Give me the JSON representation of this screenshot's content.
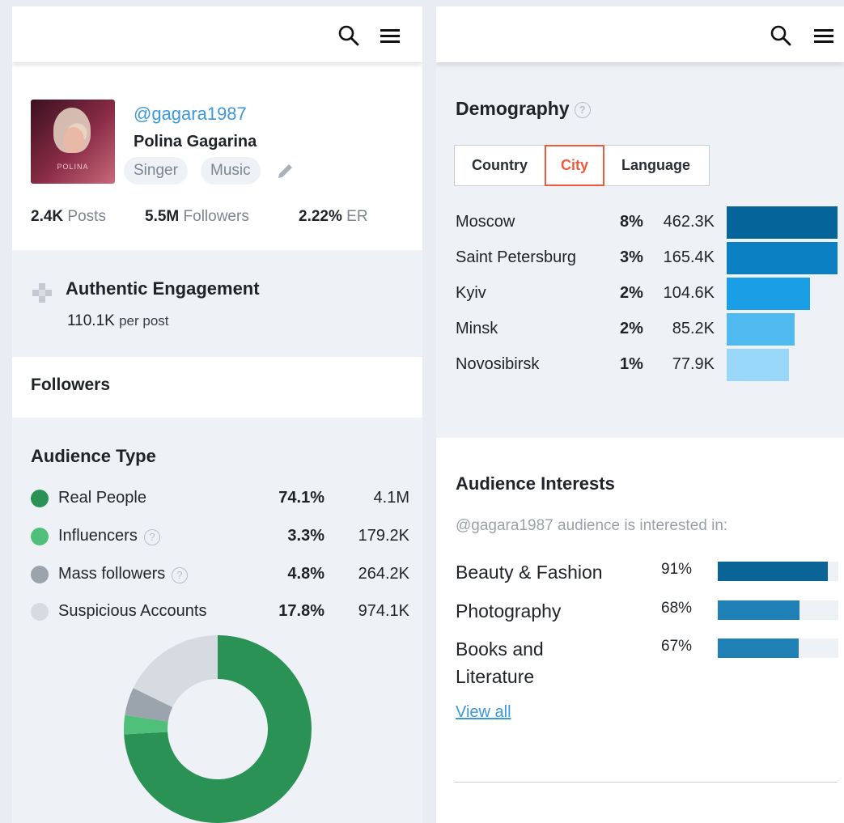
{
  "left_panel": {
    "profile": {
      "handle": "@gagara1987",
      "name": "Polina Gagarina",
      "avatar_text": "POLINA",
      "tags": [
        "Singer",
        "Music"
      ]
    },
    "stats": {
      "posts_value": "2.4K",
      "posts_label": "Posts",
      "followers_value": "5.5M",
      "followers_label": "Followers",
      "er_value": "2.22%",
      "er_label": "ER"
    },
    "authentic_engagement": {
      "title": "Authentic Engagement",
      "value": "110.1K",
      "unit": "per post"
    },
    "followers_title": "Followers",
    "audience_type": {
      "title": "Audience Type",
      "rows": [
        {
          "label": "Real People",
          "pct": "74.1%",
          "count": "4.1M",
          "color": "#2b9256",
          "help": false
        },
        {
          "label": "Influencers",
          "pct": "3.3%",
          "count": "179.2K",
          "color": "#4fbf7a",
          "help": true
        },
        {
          "label": "Mass followers",
          "pct": "4.8%",
          "count": "264.2K",
          "color": "#9ba4ad",
          "help": true
        },
        {
          "label": "Suspicious Accounts",
          "pct": "17.8%",
          "count": "974.1K",
          "color": "#d6dbe2",
          "help": false
        }
      ],
      "donut_values": [
        74.1,
        3.3,
        4.8,
        17.8
      ]
    }
  },
  "right_panel": {
    "demography": {
      "title": "Demography",
      "tabs": [
        "Country",
        "City",
        "Language"
      ],
      "active_tab": "City",
      "cities": [
        {
          "name": "Moscow",
          "pct": "8%",
          "count": "462.3K",
          "share": 1.0,
          "color": "#05659a"
        },
        {
          "name": "Saint Petersburg",
          "pct": "3%",
          "count": "165.4K",
          "share": 1.0,
          "color": "#0a7fc2"
        },
        {
          "name": "Kyiv",
          "pct": "2%",
          "count": "104.6K",
          "share": 0.75,
          "color": "#1a9ee6"
        },
        {
          "name": "Minsk",
          "pct": "2%",
          "count": "85.2K",
          "share": 0.61,
          "color": "#4fb9f0"
        },
        {
          "name": "Novosibirsk",
          "pct": "1%",
          "count": "77.9K",
          "share": 0.56,
          "color": "#98d7f8"
        }
      ]
    },
    "audience_interests": {
      "title": "Audience Interests",
      "subtitle": "@gagara1987 audience is interested in:",
      "items": [
        {
          "name": "Beauty & Fashion",
          "pct": "91%",
          "value": 91,
          "color": "#0a6496"
        },
        {
          "name": "Photography",
          "pct": "68%",
          "value": 68,
          "color": "#1e80b5"
        },
        {
          "name": "Books and Literature",
          "pct": "67%",
          "value": 67,
          "color": "#1e80b5"
        }
      ],
      "view_all": "View all"
    }
  }
}
